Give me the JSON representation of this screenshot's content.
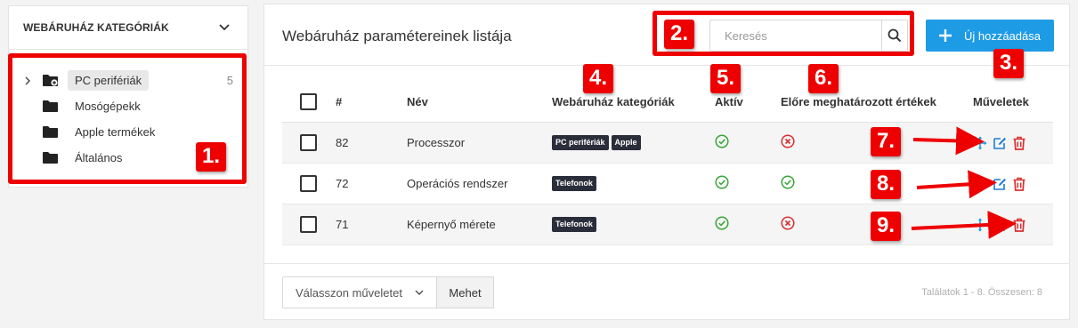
{
  "sidebar": {
    "title": "WEBÁRUHÁZ KATEGÓRIÁK",
    "items": [
      {
        "label": "PC perifériák",
        "count": "5",
        "active": true,
        "expandable": true
      },
      {
        "label": "Mosógépekk",
        "count": "",
        "active": false,
        "expandable": false
      },
      {
        "label": "Apple termékek",
        "count": "",
        "active": false,
        "expandable": false
      },
      {
        "label": "Általános",
        "count": "",
        "active": false,
        "expandable": false
      }
    ]
  },
  "header": {
    "title": "Webáruház paramétereinek listája",
    "search_placeholder": "Keresés",
    "add_label": "Új hozzáadása"
  },
  "table": {
    "columns": [
      "#",
      "Név",
      "Webáruház kategóriák",
      "Aktív",
      "Előre meghatározott értékek",
      "Műveletek"
    ],
    "rows": [
      {
        "id": "82",
        "name": "Processzor",
        "categories": [
          "PC perifériák",
          "Apple"
        ],
        "active": true,
        "predefined": false
      },
      {
        "id": "72",
        "name": "Operációs rendszer",
        "categories": [
          "Telefonok"
        ],
        "active": true,
        "predefined": true
      },
      {
        "id": "71",
        "name": "Képernyő mérete",
        "categories": [
          "Telefonok"
        ],
        "active": true,
        "predefined": false
      }
    ]
  },
  "footer": {
    "action_select": "Válasszon műveletet",
    "go_label": "Mehet",
    "results": "Találatok 1 - 8. Összesen: 8"
  },
  "annotations": [
    "1.",
    "2.",
    "3.",
    "4.",
    "5.",
    "6.",
    "7.",
    "8.",
    "9."
  ],
  "colors": {
    "accent": "#1e9be5",
    "annotation_red": "#ee0000",
    "success": "#3aa63a",
    "danger": "#d93030",
    "tag_bg": "#2a2e3a"
  }
}
